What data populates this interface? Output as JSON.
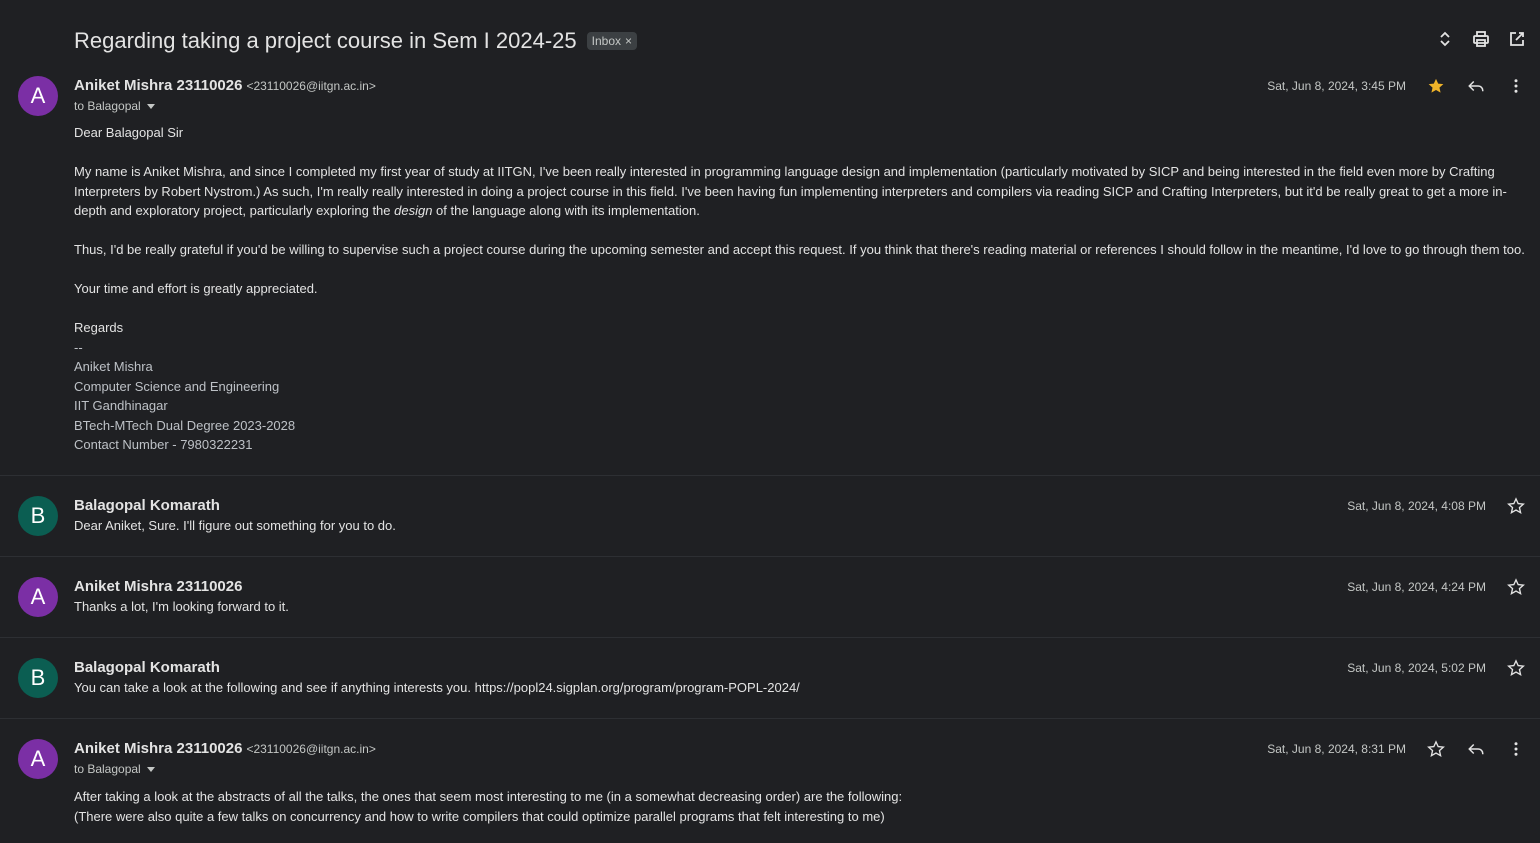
{
  "thread": {
    "subject": "Regarding taking a project course in Sem I 2024-25",
    "label_chip": "Inbox",
    "label_chip_close": "×"
  },
  "colors": {
    "background": "#1f2023",
    "avatar_a": "#7b2fa5",
    "avatar_b": "#0b5e52",
    "star_filled": "#f0b429"
  },
  "icons": [
    "expand-collapse-icon",
    "print-icon",
    "open-in-new-window-icon",
    "star-icon",
    "reply-icon",
    "more-vert-icon",
    "chevron-down-icon"
  ],
  "messages": [
    {
      "avatar": "A",
      "sender": "Aniket Mishra 23110026",
      "email": "<23110026@iitgn.ac.in>",
      "to": "to Balagopal",
      "date": "Sat, Jun 8, 2024, 3:45 PM",
      "starred": true,
      "greeting": "Dear Balagopal Sir",
      "para1_a": "My name is Aniket Mishra, and since I completed my first year of study at IITGN, I've been really interested in programming language design and implementation (particularly motivated by SICP and being interested in the field even more by Crafting Interpreters by Robert Nystrom.) As such, I'm really really interested in doing a project course in this field. I've been having fun implementing interpreters and compilers via reading SICP and Crafting Interpreters, but it'd be really great to get a more in-depth and exploratory project, particularly exploring the ",
      "para1_em": "design",
      "para1_b": " of the language along with its implementation.",
      "para2": "Thus, I'd be really grateful if you'd be willing to supervise such a project course during the upcoming semester and accept this request. If you think that there's reading material or references I should follow in the meantime, I'd love to go through them too.",
      "para3": "Your time and effort is greatly appreciated.",
      "regards": "Regards",
      "signature": [
        "--",
        "Aniket Mishra",
        "Computer Science and Engineering",
        "IIT Gandhinagar",
        "BTech-MTech Dual Degree 2023-2028",
        "Contact Number - 7980322231"
      ]
    },
    {
      "avatar": "B",
      "sender": "Balagopal Komarath",
      "date": "Sat, Jun 8, 2024, 4:08 PM",
      "starred": false,
      "snippet": "Dear Aniket, Sure. I'll figure out something for you to do."
    },
    {
      "avatar": "A",
      "sender": "Aniket Mishra 23110026",
      "date": "Sat, Jun 8, 2024, 4:24 PM",
      "starred": false,
      "snippet": "Thanks a lot, I'm looking forward to it."
    },
    {
      "avatar": "B",
      "sender": "Balagopal Komarath",
      "date": "Sat, Jun 8, 2024, 5:02 PM",
      "starred": false,
      "snippet": "You can take a look at the following and see if anything interests you. https://popl24.sigplan.org/program/program-POPL-2024/"
    },
    {
      "avatar": "A",
      "sender": "Aniket Mishra 23110026",
      "email": "<23110026@iitgn.ac.in>",
      "to": "to Balagopal",
      "date": "Sat, Jun 8, 2024, 8:31 PM",
      "starred": false,
      "line1": "After taking a look at the abstracts of all the talks, the ones that seem most interesting to me (in a somewhat decreasing order) are the following:",
      "line2": "(There were also quite a few talks on concurrency and how to write compilers that could optimize parallel programs that felt interesting to me)"
    }
  ]
}
